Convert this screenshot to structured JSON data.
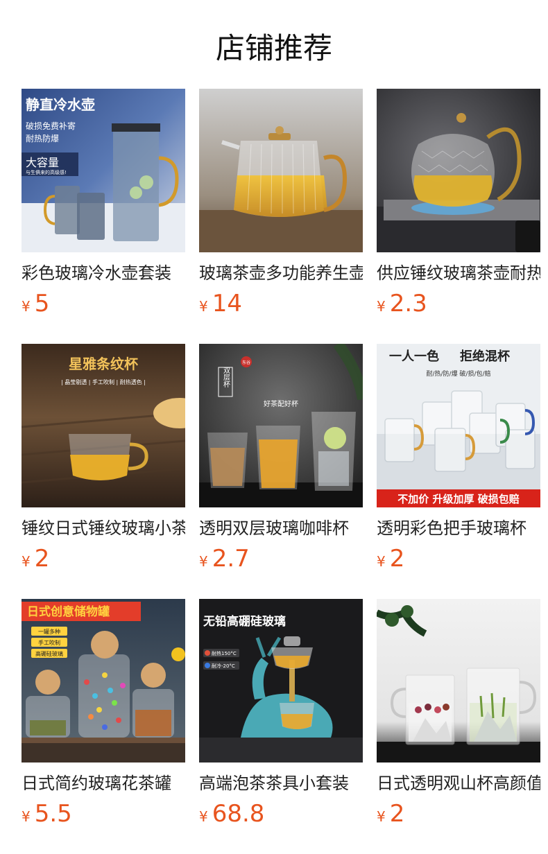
{
  "page": {
    "title": "店铺推荐"
  },
  "currency": "¥",
  "products": [
    {
      "name": "彩色玻璃冷水壶套装",
      "price": "5",
      "image": {
        "headline": "静直冷水壶",
        "lines": [
          "破损免费补寄",
          "耐热防爆"
        ],
        "badge": "大容量",
        "badge_sub": "与生俱来的高级感!"
      }
    },
    {
      "name": "玻璃茶壶多功能养生壶",
      "price": "14",
      "image": {}
    },
    {
      "name": "供应锤纹玻璃茶壶耐热",
      "price": "2.3",
      "image": {}
    },
    {
      "name": "锤纹日式锤纹玻璃小茶杯",
      "price": "2",
      "image": {
        "headline": "星雅条纹杯",
        "sub": "| 晶莹剔透 | 手工吹制 | 耐热透色 |"
      }
    },
    {
      "name": "透明双层玻璃咖啡杯",
      "price": "2.7",
      "image": {
        "vertical": "双层杯",
        "seal": "东谷",
        "tagline": "好茶配好杯"
      }
    },
    {
      "name": "透明彩色把手玻璃杯",
      "price": "2",
      "image": {
        "headline_a": "一人一色",
        "headline_b": "拒绝混杯",
        "sub": "耐/热/防/爆  破/损/包/赔",
        "banner": "不加价 升级加厚 破损包赔"
      }
    },
    {
      "name": "日式简约玻璃花茶罐",
      "price": "5.5",
      "image": {
        "headline": "日式创意储物罐",
        "tags": [
          "一罐多种",
          "手工吹制",
          "高硼硅玻璃"
        ]
      }
    },
    {
      "name": "高端泡茶茶具小套装",
      "price": "68.8",
      "image": {
        "headline": "无铅高硼硅玻璃",
        "badges": [
          "耐热150°C",
          "耐冷-20°C"
        ]
      }
    },
    {
      "name": "日式透明观山杯高颜值",
      "price": "2",
      "image": {}
    }
  ],
  "colors": {
    "price": "#e8541e",
    "title": "#111111",
    "name": "#222222"
  }
}
